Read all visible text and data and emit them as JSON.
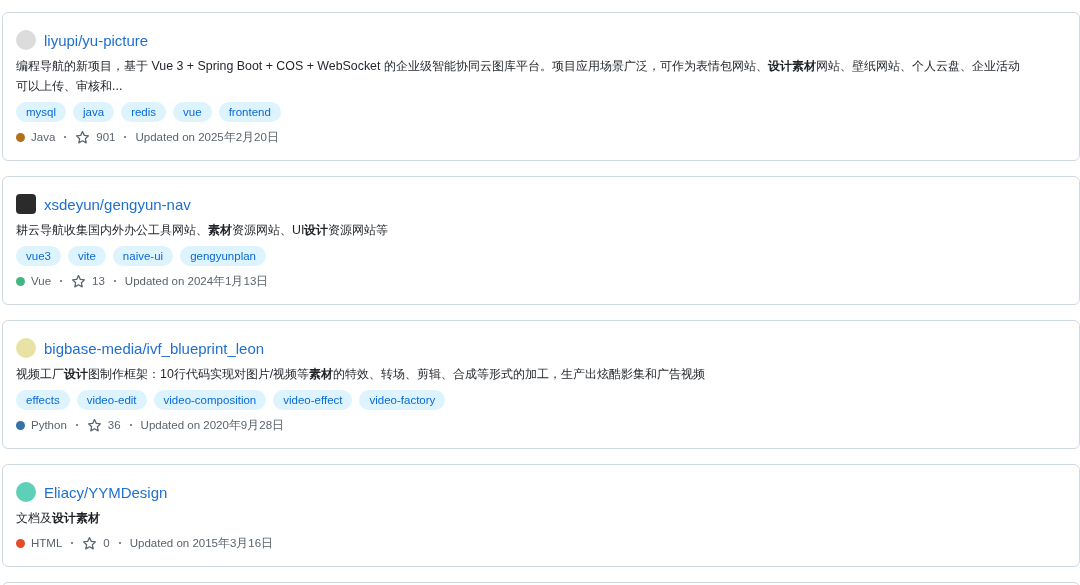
{
  "repos": [
    {
      "name": "liyupi/yu-picture",
      "description_lines": [
        "编程导航的新项目，基于 Vue 3 + Spring Boot + COS + WebSocket 的企业级智能协同云图库平台。项目应用场景广泛，可作为表情包网站、**设计素材**网站、壁纸网站、个人云盘、企业活动",
        "可以上传、审核和..."
      ],
      "tags": [
        "mysql",
        "java",
        "redis",
        "vue",
        "frontend"
      ],
      "language": "Java",
      "color": "#b07219",
      "stars": "901",
      "updated": "Updated on 2025年2月20日"
    },
    {
      "name": "xsdeyun/gengyun-nav",
      "description_lines": [
        "耕云导航收集国内外办公工具网站、**素材**资源网站、UI**设计**资源网站等"
      ],
      "tags": [
        "vue3",
        "vite",
        "naive-ui",
        "gengyunplan"
      ],
      "language": "Vue",
      "color": "#41b883",
      "stars": "13",
      "updated": "Updated on 2024年1月13日"
    },
    {
      "name": "bigbase-media/ivf_blueprint_leon",
      "description_lines": [
        "视频工厂**设计**图制作框架：10行代码实现对图片/视频等**素材**的特效、转场、剪辑、合成等形式的加工，生产出炫酷影集和广告视频"
      ],
      "tags": [
        "effects",
        "video-edit",
        "video-composition",
        "video-effect",
        "video-factory"
      ],
      "language": "Python",
      "color": "#3572a5",
      "stars": "36",
      "updated": "Updated on 2020年9月28日"
    },
    {
      "name": "Eliacy/YYMDesign",
      "description_lines": [
        "文档及**设计素材**"
      ],
      "language": "HTML",
      "color": "#e34c26",
      "stars": "0",
      "updated": "Updated on 2015年3月16日"
    }
  ]
}
